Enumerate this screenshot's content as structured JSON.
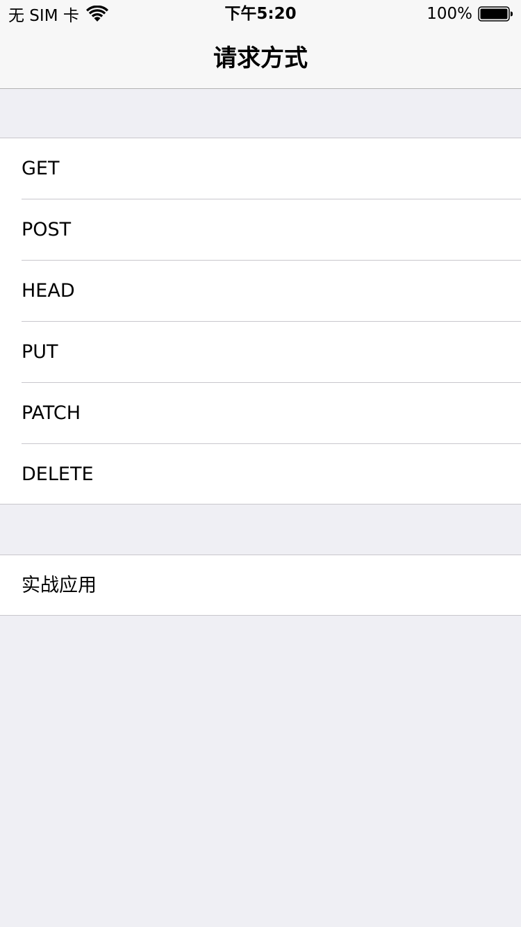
{
  "status_bar": {
    "carrier": "无 SIM 卡",
    "time": "下午5:20",
    "battery_percent": "100%",
    "wifi_icon": "wifi-icon",
    "battery_icon": "battery-icon",
    "battery_level": 1.0
  },
  "nav": {
    "title": "请求方式"
  },
  "sections": [
    {
      "items": [
        {
          "label": "GET"
        },
        {
          "label": "POST"
        },
        {
          "label": "HEAD"
        },
        {
          "label": "PUT"
        },
        {
          "label": "PATCH"
        },
        {
          "label": "DELETE"
        }
      ]
    },
    {
      "items": [
        {
          "label": "实战应用"
        }
      ]
    }
  ],
  "colors": {
    "background": "#EFEFF4",
    "bar_background": "#F7F7F7",
    "cell_background": "#FFFFFF",
    "separator": "#C8C7CC",
    "text": "#000000"
  }
}
